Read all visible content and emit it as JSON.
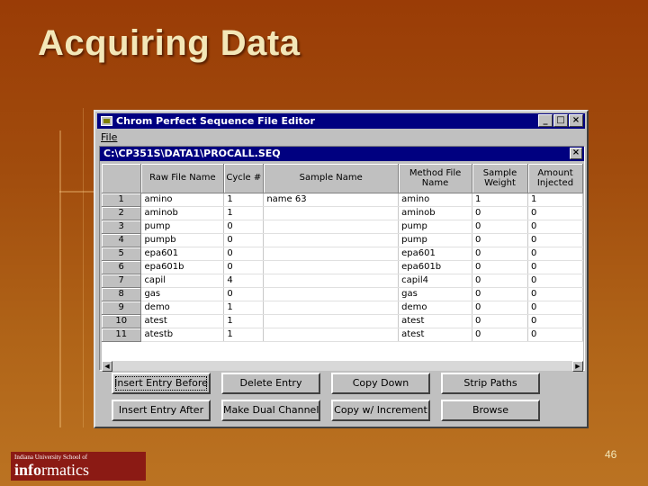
{
  "slide": {
    "title": "Acquiring Data",
    "page_number": "46"
  },
  "window": {
    "title": "Chrom Perfect Sequence File Editor",
    "menu": [
      "File"
    ],
    "controls": {
      "minimize": "_",
      "maximize": "□",
      "close": "×"
    }
  },
  "child": {
    "title": "C:\\CP351S\\DATA1\\PROCALL.SEQ",
    "close": "×"
  },
  "grid": {
    "headers": [
      "",
      "Raw File Name",
      "Cycle #",
      "Sample Name",
      "Method File Name",
      "Sample Weight",
      "Amount Injected"
    ],
    "rows": [
      [
        "1",
        "amino",
        "1",
        "name 63",
        "amino",
        "1",
        "1"
      ],
      [
        "2",
        "aminob",
        "1",
        "",
        "aminob",
        "0",
        "0"
      ],
      [
        "3",
        "pump",
        "0",
        "",
        "pump",
        "0",
        "0"
      ],
      [
        "4",
        "pumpb",
        "0",
        "",
        "pump",
        "0",
        "0"
      ],
      [
        "5",
        "epa601",
        "0",
        "",
        "epa601",
        "0",
        "0"
      ],
      [
        "6",
        "epa601b",
        "0",
        "",
        "epa601b",
        "0",
        "0"
      ],
      [
        "7",
        "capil",
        "4",
        "",
        "capil4",
        "0",
        "0"
      ],
      [
        "8",
        "gas",
        "0",
        "",
        "gas",
        "0",
        "0"
      ],
      [
        "9",
        "demo",
        "1",
        "",
        "demo",
        "0",
        "0"
      ],
      [
        "10",
        "atest",
        "1",
        "",
        "atest",
        "0",
        "0"
      ],
      [
        "11",
        "atestb",
        "1",
        "",
        "atest",
        "0",
        "0"
      ]
    ],
    "scroll_left": "◀",
    "scroll_right": "▶"
  },
  "buttons": {
    "insert_before": "Insert Entry Before",
    "delete_entry": "Delete Entry",
    "copy_down": "Copy Down",
    "strip_paths": "Strip Paths",
    "insert_after": "Insert Entry After",
    "make_dual": "Make Dual Channel",
    "copy_increment": "Copy w/ Increment",
    "browse": "Browse"
  },
  "logo": {
    "small": "Indiana University School of",
    "main_bold": "info",
    "main_rest": "rmatics"
  },
  "colors": {
    "titlebar": "#000080",
    "window": "#c0c0c0",
    "logo_bg": "#8b1a14"
  }
}
